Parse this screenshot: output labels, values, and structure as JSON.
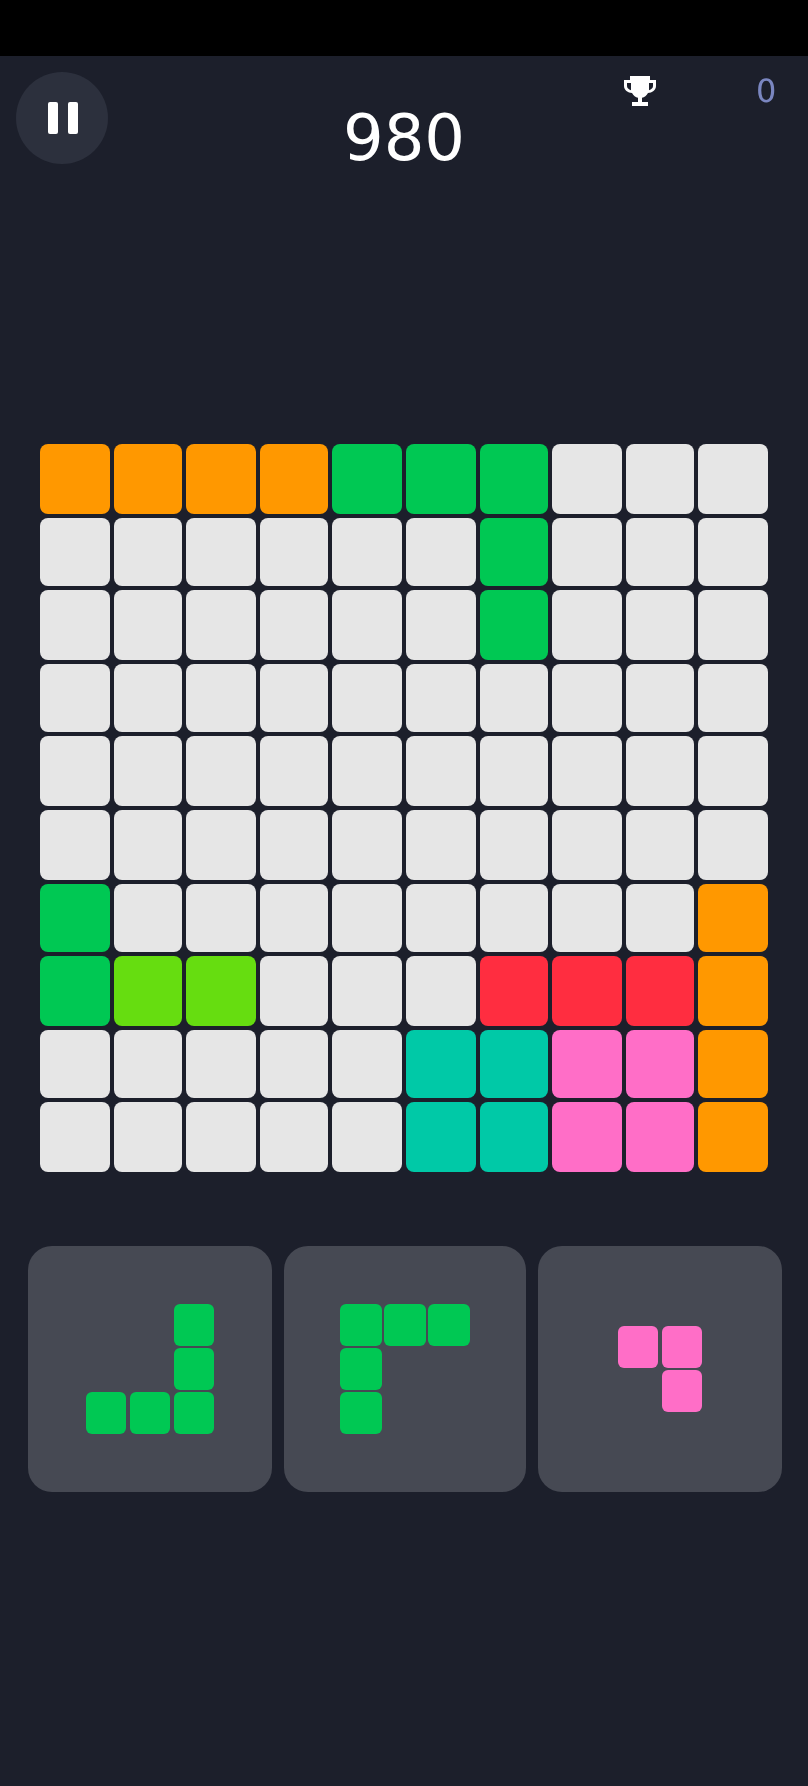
{
  "score": "980",
  "best": "0",
  "board": {
    "rows": [
      {
        "cells": [
          {
            "filled": true,
            "color": "#ff9800"
          },
          {
            "filled": true,
            "color": "#ff9800"
          },
          {
            "filled": true,
            "color": "#ff9800"
          },
          {
            "filled": true,
            "color": "#ff9800"
          },
          {
            "filled": true,
            "color": "#00c853"
          },
          {
            "filled": true,
            "color": "#00c853"
          },
          {
            "filled": true,
            "color": "#00c853"
          },
          {
            "filled": false
          },
          {
            "filled": false
          },
          {
            "filled": false
          }
        ]
      },
      {
        "cells": [
          {
            "filled": false
          },
          {
            "filled": false
          },
          {
            "filled": false
          },
          {
            "filled": false
          },
          {
            "filled": false
          },
          {
            "filled": false
          },
          {
            "filled": true,
            "color": "#00c853"
          },
          {
            "filled": false
          },
          {
            "filled": false
          },
          {
            "filled": false
          }
        ]
      },
      {
        "cells": [
          {
            "filled": false
          },
          {
            "filled": false
          },
          {
            "filled": false
          },
          {
            "filled": false
          },
          {
            "filled": false
          },
          {
            "filled": false
          },
          {
            "filled": true,
            "color": "#00c853"
          },
          {
            "filled": false
          },
          {
            "filled": false
          },
          {
            "filled": false
          }
        ]
      },
      {
        "cells": [
          {
            "filled": false
          },
          {
            "filled": false
          },
          {
            "filled": false
          },
          {
            "filled": false
          },
          {
            "filled": false
          },
          {
            "filled": false
          },
          {
            "filled": false
          },
          {
            "filled": false
          },
          {
            "filled": false
          },
          {
            "filled": false
          }
        ]
      },
      {
        "cells": [
          {
            "filled": false
          },
          {
            "filled": false
          },
          {
            "filled": false
          },
          {
            "filled": false
          },
          {
            "filled": false
          },
          {
            "filled": false
          },
          {
            "filled": false
          },
          {
            "filled": false
          },
          {
            "filled": false
          },
          {
            "filled": false
          }
        ]
      },
      {
        "cells": [
          {
            "filled": false
          },
          {
            "filled": false
          },
          {
            "filled": false
          },
          {
            "filled": false
          },
          {
            "filled": false
          },
          {
            "filled": false
          },
          {
            "filled": false
          },
          {
            "filled": false
          },
          {
            "filled": false
          },
          {
            "filled": false
          }
        ]
      },
      {
        "cells": [
          {
            "filled": true,
            "color": "#00c853"
          },
          {
            "filled": false
          },
          {
            "filled": false
          },
          {
            "filled": false
          },
          {
            "filled": false
          },
          {
            "filled": false
          },
          {
            "filled": false
          },
          {
            "filled": false
          },
          {
            "filled": false
          },
          {
            "filled": true,
            "color": "#ff9800"
          }
        ]
      },
      {
        "cells": [
          {
            "filled": true,
            "color": "#00c853"
          },
          {
            "filled": true,
            "color": "#66dd10"
          },
          {
            "filled": true,
            "color": "#66dd10"
          },
          {
            "filled": false
          },
          {
            "filled": false
          },
          {
            "filled": false
          },
          {
            "filled": true,
            "color": "#ff2d40"
          },
          {
            "filled": true,
            "color": "#ff2d40"
          },
          {
            "filled": true,
            "color": "#ff2d40"
          },
          {
            "filled": true,
            "color": "#ff9800"
          }
        ]
      },
      {
        "cells": [
          {
            "filled": false
          },
          {
            "filled": false
          },
          {
            "filled": false
          },
          {
            "filled": false
          },
          {
            "filled": false
          },
          {
            "filled": true,
            "color": "#00c9a7"
          },
          {
            "filled": true,
            "color": "#00c9a7"
          },
          {
            "filled": true,
            "color": "#ff6ec7"
          },
          {
            "filled": true,
            "color": "#ff6ec7"
          },
          {
            "filled": true,
            "color": "#ff9800"
          }
        ]
      },
      {
        "cells": [
          {
            "filled": false
          },
          {
            "filled": false
          },
          {
            "filled": false
          },
          {
            "filled": false
          },
          {
            "filled": false
          },
          {
            "filled": true,
            "color": "#00c9a7"
          },
          {
            "filled": true,
            "color": "#00c9a7"
          },
          {
            "filled": true,
            "color": "#ff6ec7"
          },
          {
            "filled": true,
            "color": "#ff6ec7"
          },
          {
            "filled": true,
            "color": "#ff9800"
          }
        ]
      }
    ]
  },
  "pieces": [
    {
      "color": "#00c853",
      "shape": [
        [
          false,
          false,
          true
        ],
        [
          false,
          false,
          true
        ],
        [
          true,
          true,
          true
        ]
      ]
    },
    {
      "color": "#00c853",
      "shape": [
        [
          true,
          true,
          true
        ],
        [
          true,
          false,
          false
        ],
        [
          true,
          false,
          false
        ]
      ]
    },
    {
      "color": "#ff6ec7",
      "shape": [
        [
          true,
          true
        ],
        [
          false,
          true
        ]
      ]
    }
  ]
}
